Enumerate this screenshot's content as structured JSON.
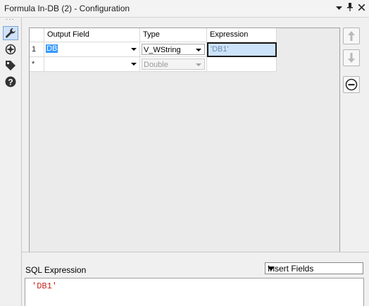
{
  "window": {
    "title": "Formula In-DB (2) - Configuration",
    "controls": {
      "dropdown": "▾",
      "pin": "📌",
      "close": "✕"
    }
  },
  "sidebar": {
    "icons": [
      "wrench-icon",
      "target-icon",
      "tag-icon",
      "help-icon"
    ]
  },
  "grid": {
    "headers": {
      "output_field": "Output Field",
      "type": "Type",
      "expression": "Expression"
    },
    "rows": [
      {
        "num": "1",
        "output_field": "DB",
        "type": "V_WString",
        "expression": "'DB1'"
      },
      {
        "num": "*",
        "output_field": "",
        "type": "Double",
        "expression": ""
      }
    ]
  },
  "sql": {
    "label": "SQL Expression",
    "insert_fields": "Insert Fields",
    "code": "'DB1'"
  },
  "colors": {
    "selection": "#3399ff",
    "sql_string": "#c8261e",
    "accent_icon": "#1b5fa8"
  }
}
